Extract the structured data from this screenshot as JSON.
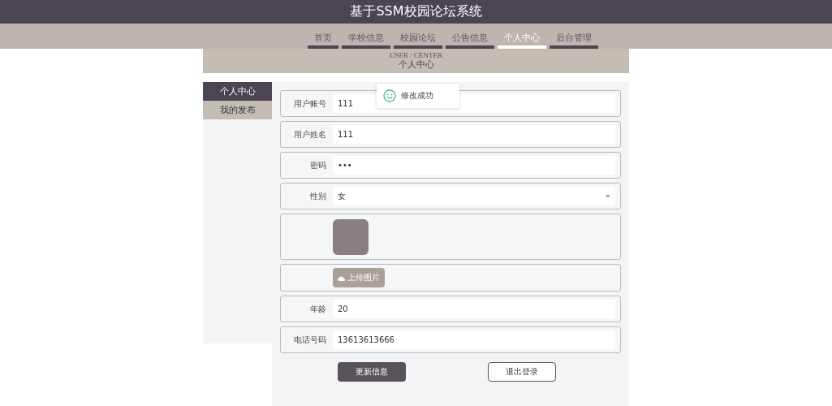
{
  "header": {
    "title": "基于SSM校园论坛系统"
  },
  "nav": [
    {
      "label": "首页",
      "selected": false
    },
    {
      "label": "学校信息",
      "selected": false
    },
    {
      "label": "校园论坛",
      "selected": false
    },
    {
      "label": "公告信息",
      "selected": false
    },
    {
      "label": "个人中心",
      "selected": true
    },
    {
      "label": "后台管理",
      "selected": false
    }
  ],
  "banner": {
    "subtitle": "USER / CENTER",
    "title": "个人中心"
  },
  "sidebar": [
    {
      "label": "个人中心",
      "selected": true
    },
    {
      "label": "我的发布",
      "selected": false
    }
  ],
  "form": [
    {
      "kind": "text",
      "label": "用户账号",
      "value": "111"
    },
    {
      "kind": "text",
      "label": "用户姓名",
      "value": "111"
    },
    {
      "kind": "text",
      "label": "密码",
      "value": "•••"
    },
    {
      "kind": "select",
      "label": "性别",
      "value": "女"
    },
    {
      "kind": "image"
    },
    {
      "kind": "upload",
      "button": "上传图片"
    },
    {
      "kind": "text",
      "label": "年龄",
      "value": "20"
    },
    {
      "kind": "text",
      "label": "电话号码",
      "value": "13613613666"
    }
  ],
  "actions": [
    {
      "label": "更新信息",
      "kind": "primary"
    },
    {
      "label": "退出登录",
      "kind": "outline"
    }
  ],
  "toast": {
    "message": "修改成功"
  }
}
